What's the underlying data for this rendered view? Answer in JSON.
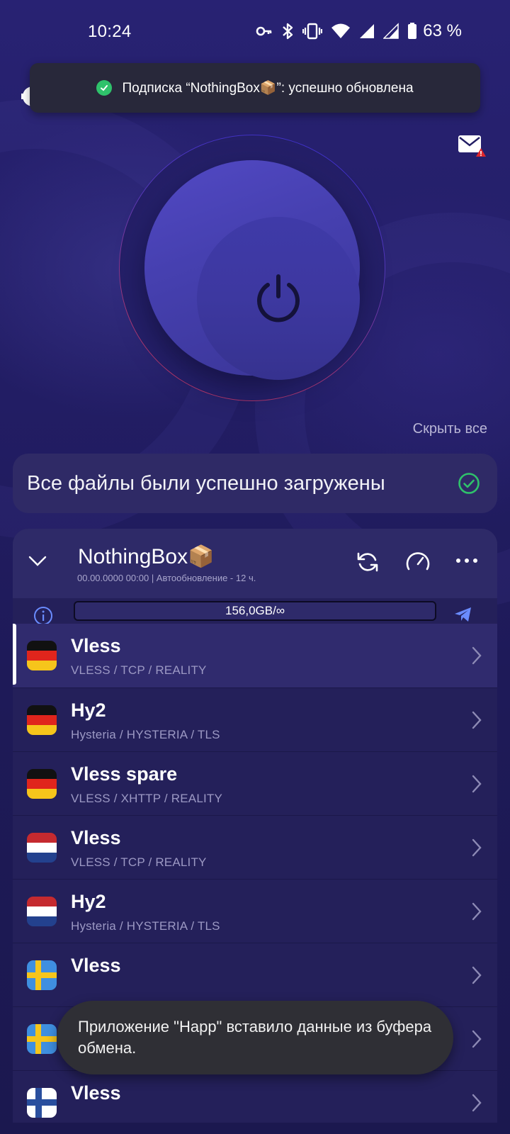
{
  "status_bar": {
    "time": "10:24",
    "battery": "63 %",
    "icons": [
      "vpn-key-icon",
      "bluetooth-icon",
      "vibrate-icon",
      "wifi-icon",
      "signal-icon",
      "signal-icon",
      "battery-icon"
    ]
  },
  "top_toast": {
    "text": "Подписка “NothingBox📦”: успешно обновлена",
    "icon": "check-circle-icon",
    "color": "#2fc26b"
  },
  "hide_all_label": "Скрыть все",
  "files_status": {
    "text": "Все файлы были успешно загружены",
    "icon": "check-circle-icon"
  },
  "group": {
    "title": "NothingBox📦",
    "subtitle": "00.00.0000 00:00  | Автообновление - 12 ч.",
    "traffic": "156,0GB/∞"
  },
  "servers": [
    {
      "name": "Vless",
      "protocol": "VLESS / TCP / REALITY",
      "flag": "de",
      "selected": true
    },
    {
      "name": "Hy2",
      "protocol": "Hysteria / HYSTERIA / TLS",
      "flag": "de"
    },
    {
      "name": "Vless spare",
      "protocol": "VLESS / XHTTP / REALITY",
      "flag": "de"
    },
    {
      "name": "Vless",
      "protocol": "VLESS / TCP / REALITY",
      "flag": "nl"
    },
    {
      "name": "Hy2",
      "protocol": "Hysteria / HYSTERIA / TLS",
      "flag": "nl"
    },
    {
      "name": "Vless",
      "protocol": "",
      "flag": "se"
    },
    {
      "name": "",
      "protocol": "",
      "flag": "se"
    },
    {
      "name": "Vless",
      "protocol": "",
      "flag": "fi"
    }
  ],
  "bottom_toast": {
    "text": "Приложение \"Happ\" вставило данные из буфера обмена."
  },
  "colors": {
    "background": "#221d64",
    "accent": "#4a44b8",
    "success": "#2fc26b",
    "telegram": "#6a8cff"
  }
}
